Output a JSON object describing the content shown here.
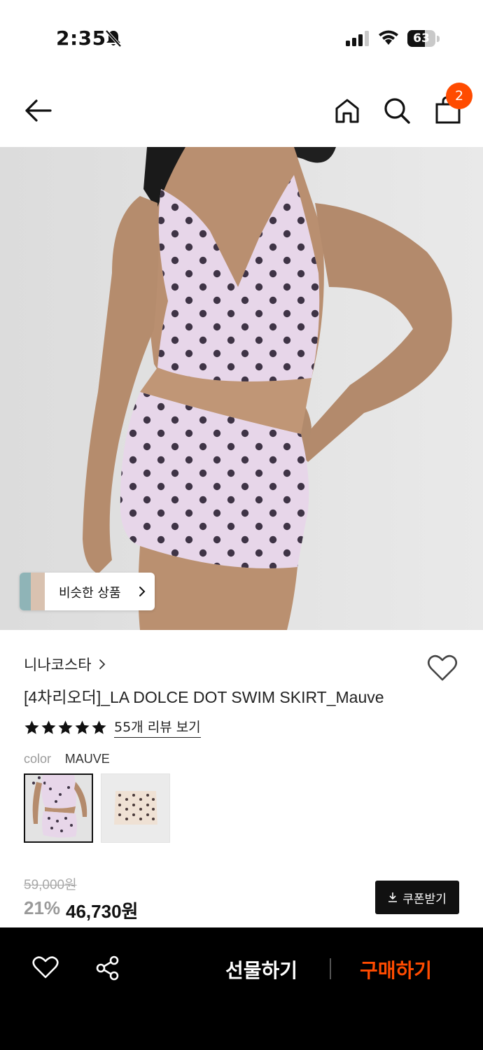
{
  "status_bar": {
    "time": "2:35",
    "battery": "63",
    "battery_level": 0.63
  },
  "header": {
    "cart_count": "2"
  },
  "hero": {
    "similar_label": "비슷한 상품"
  },
  "product": {
    "brand": "니나코스타",
    "title": "[4차리오더]_LA DOLCE DOT SWIM SKIRT_Mauve",
    "rating": 5,
    "review_link": "55개 리뷰 보기",
    "color_label": "color",
    "color_value": "MAUVE",
    "original_price": "59,000원",
    "discount": "21%",
    "sale_price": "46,730원",
    "coupon_label": "쿠폰받기"
  },
  "bottom_bar": {
    "gift_label": "선물하기",
    "buy_label": "구매하기"
  },
  "colors": {
    "accent": "#ff4b00",
    "dot": "#3f3446",
    "fabric": "#e7d6e9"
  }
}
